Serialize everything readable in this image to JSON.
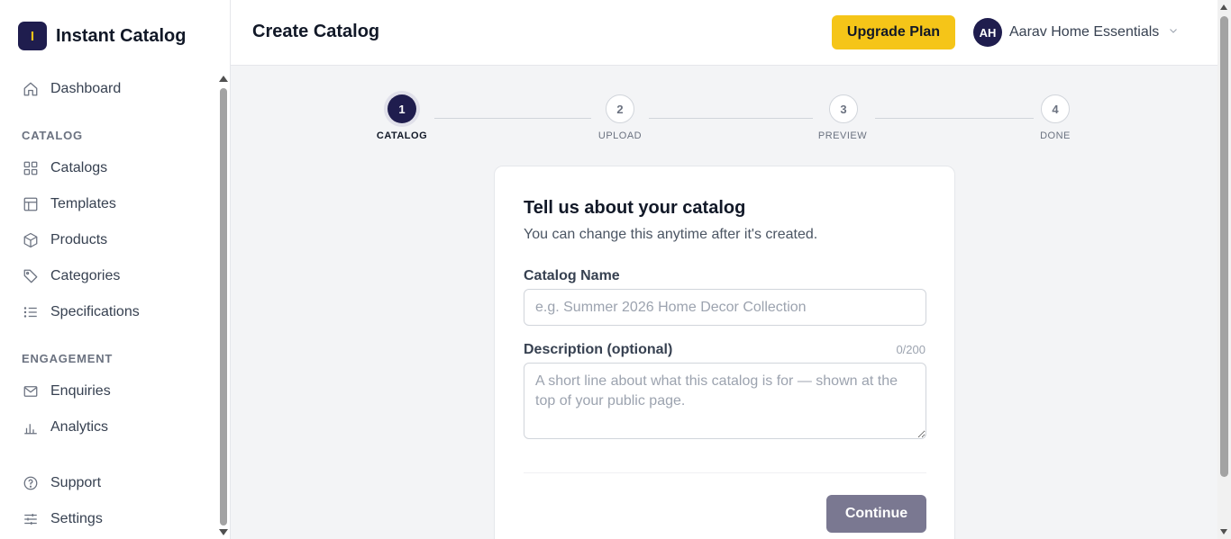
{
  "brand": {
    "logo_letter": "I",
    "name": "Instant Catalog"
  },
  "sidebar": {
    "dashboard": "Dashboard",
    "section_catalog": "CATALOG",
    "catalog_items": [
      "Catalogs",
      "Templates",
      "Products",
      "Categories",
      "Specifications"
    ],
    "section_engagement": "ENGAGEMENT",
    "engagement_items": [
      "Enquiries",
      "Analytics"
    ],
    "footer_items": [
      "Support",
      "Settings"
    ]
  },
  "header": {
    "title": "Create Catalog",
    "upgrade_label": "Upgrade Plan",
    "user_initials": "AH",
    "user_name": "Aarav Home Essentials"
  },
  "stepper": {
    "current": 1,
    "steps": [
      {
        "number": "1",
        "label": "CATALOG"
      },
      {
        "number": "2",
        "label": "UPLOAD"
      },
      {
        "number": "3",
        "label": "PREVIEW"
      },
      {
        "number": "4",
        "label": "DONE"
      }
    ]
  },
  "form": {
    "title": "Tell us about your catalog",
    "subtitle": "You can change this anytime after it's created.",
    "name_label": "Catalog Name",
    "name_value": "",
    "name_placeholder": "e.g. Summer 2026 Home Decor Collection",
    "description_label": "Description (optional)",
    "description_counter": "0/200",
    "description_value": "",
    "description_placeholder": "A short line about what this catalog is for — shown at the top of your public page.",
    "continue_label": "Continue"
  },
  "colors": {
    "brand_navy": "#1f1d4e",
    "accent_yellow": "#f5c518",
    "continue_disabled": "#7a7891"
  }
}
